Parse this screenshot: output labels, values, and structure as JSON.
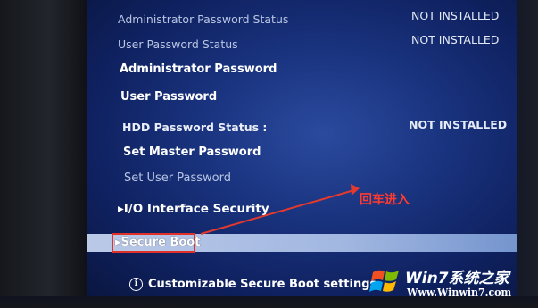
{
  "rows": {
    "admin_status_label": "Administrator Password Status",
    "admin_status_value": "NOT INSTALLED",
    "user_status_label": "User Password Status",
    "user_status_value": "NOT INSTALLED",
    "admin_password": "Administrator Password",
    "user_password": "User Password",
    "hdd_status_label": "HDD Password Status  :",
    "hdd_status_value": "NOT INSTALLED",
    "set_master": "Set Master Password",
    "set_user": "Set User Password",
    "io_security": "I/O Interface Security",
    "secure_boot": "Secure Boot"
  },
  "help": {
    "icon": "i",
    "text": "Customizable Secure Boot settings"
  },
  "annotation": {
    "text": "回车进入",
    "color": "#ff3b2f"
  },
  "watermark": {
    "title": "Win7系统之家",
    "url": "Www.Winwin7.com"
  },
  "colors": {
    "highlight": "#b8ccef",
    "screen_blue": "#1a3480",
    "annotation_red": "#e0302a"
  }
}
